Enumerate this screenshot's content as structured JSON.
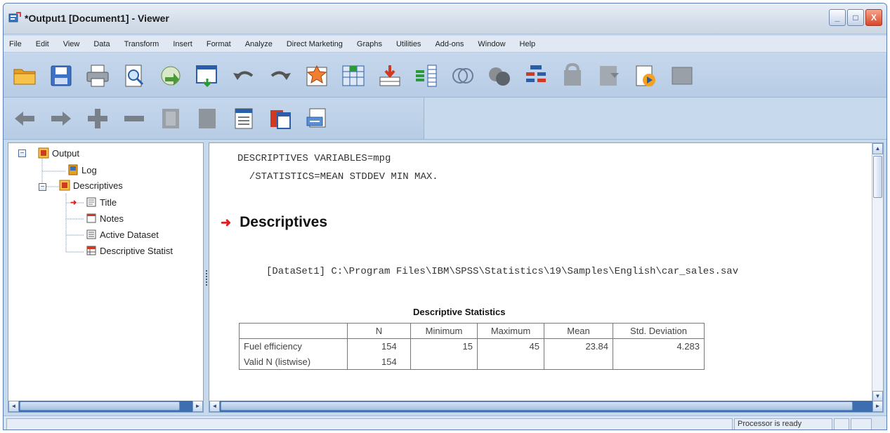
{
  "window": {
    "title": "*Output1 [Document1] - Viewer",
    "controls": {
      "minimize": "_",
      "maximize": "□",
      "close": "X"
    }
  },
  "menu": [
    "File",
    "Edit",
    "View",
    "Data",
    "Transform",
    "Insert",
    "Format",
    "Analyze",
    "Direct Marketing",
    "Graphs",
    "Utilities",
    "Add-ons",
    "Window",
    "Help"
  ],
  "toolbar1": [
    "open-icon",
    "save-icon",
    "print-icon",
    "print-preview-icon",
    "export-icon",
    "recall-dialog-icon",
    "undo-icon",
    "redo-icon",
    "goto-case-icon",
    "goto-variable-icon",
    "insert-cases-icon",
    "variables-icon",
    "run-descriptives-icon",
    "use-sets-icon",
    "split-file-icon",
    "designate-window-icon",
    "show-all-icon",
    "spelling-icon",
    "toggle-icon"
  ],
  "toolbar2": [
    "promote-icon",
    "demote-icon",
    "expand-icon",
    "collapse-icon",
    "show-icon",
    "hide-icon",
    "insert-heading-icon",
    "insert-title-icon",
    "insert-text-icon"
  ],
  "outline": {
    "nodes": [
      {
        "label": "Output",
        "icon": "output-book-icon"
      },
      {
        "label": "Log",
        "icon": "log-icon"
      },
      {
        "label": "Descriptives",
        "icon": "procedure-book-icon"
      },
      {
        "label": "Title",
        "icon": "title-icon"
      },
      {
        "label": "Notes",
        "icon": "notes-icon"
      },
      {
        "label": "Active Dataset",
        "icon": "dataset-icon"
      },
      {
        "label": "Descriptive Statist",
        "icon": "pivot-table-icon"
      }
    ],
    "expander": "−"
  },
  "content": {
    "syntax_line1": "DESCRIPTIVES VARIABLES=mpg",
    "syntax_line2": "  /STATISTICS=MEAN STDDEV MIN MAX.",
    "heading_arrow": "➜",
    "heading": "Descriptives",
    "dataset_line": "[DataSet1] C:\\Program Files\\IBM\\SPSS\\Statistics\\19\\Samples\\English\\car_sales.sav",
    "table": {
      "title": "Descriptive Statistics",
      "columns": [
        "",
        "N",
        "Minimum",
        "Maximum",
        "Mean",
        "Std. Deviation"
      ],
      "rows": [
        [
          "Fuel efficiency",
          "154",
          "15",
          "45",
          "23.84",
          "4.283"
        ],
        [
          "Valid N (listwise)",
          "154",
          "",
          "",
          "",
          ""
        ]
      ]
    }
  },
  "scroll_arrows": {
    "up": "▲",
    "down": "▼",
    "left": "◄",
    "right": "►"
  },
  "status": {
    "processor": "Processor is ready"
  }
}
